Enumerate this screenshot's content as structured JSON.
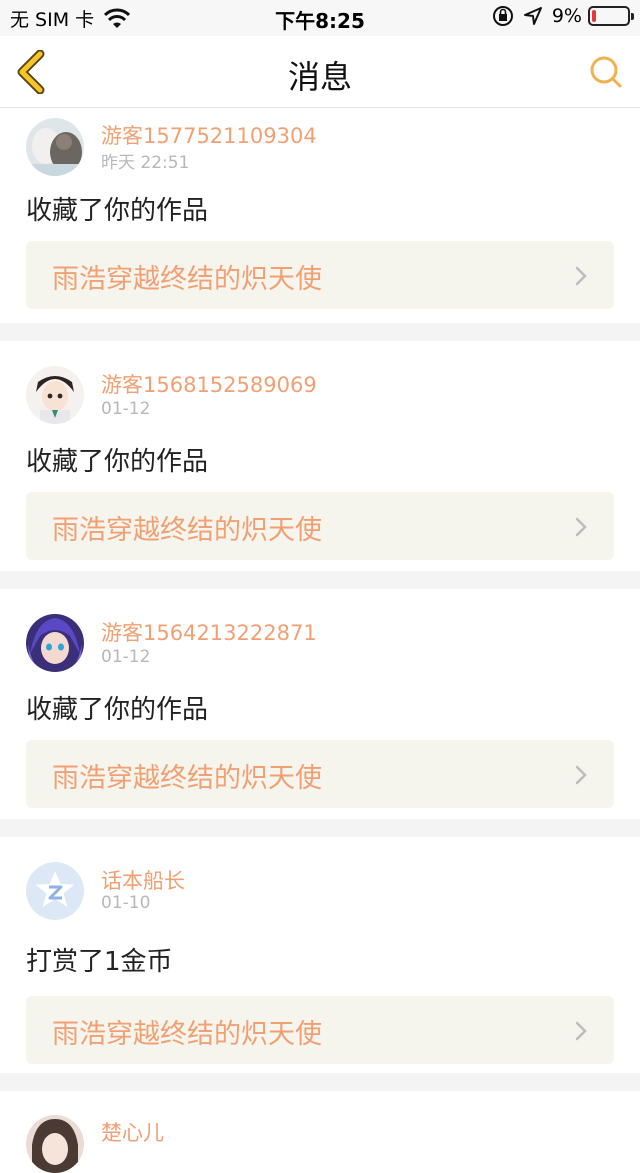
{
  "status_bar": {
    "carrier": "无 SIM 卡",
    "time": "下午8:25",
    "battery": "9%",
    "icons": [
      "wifi-icon",
      "orientation-lock-icon",
      "location-icon",
      "battery-icon"
    ]
  },
  "nav": {
    "title": "消息",
    "back_icon": "chevron-left-icon",
    "search_icon": "search-icon",
    "accent": "#f6b026"
  },
  "messages": [
    {
      "user": "游客1577521109304",
      "date": "昨天 22:51",
      "action": "收藏了你的作品",
      "work": "雨浩穿越终结的炽天使"
    },
    {
      "user": "游客1568152589069",
      "date": "01-12",
      "action": "收藏了你的作品",
      "work": "雨浩穿越终结的炽天使"
    },
    {
      "user": "游客1564213222871",
      "date": "01-12",
      "action": "收藏了你的作品",
      "work": "雨浩穿越终结的炽天使"
    },
    {
      "user": "话本船长",
      "date": "01-10",
      "action": "打赏了1金币",
      "work": "雨浩穿越终结的炽天使"
    },
    {
      "user": "楚心儿"
    }
  ],
  "colors": {
    "accent_orange": "#f0a073",
    "card_bg": "#f5f5ee",
    "separator": "#f4f4f4"
  }
}
